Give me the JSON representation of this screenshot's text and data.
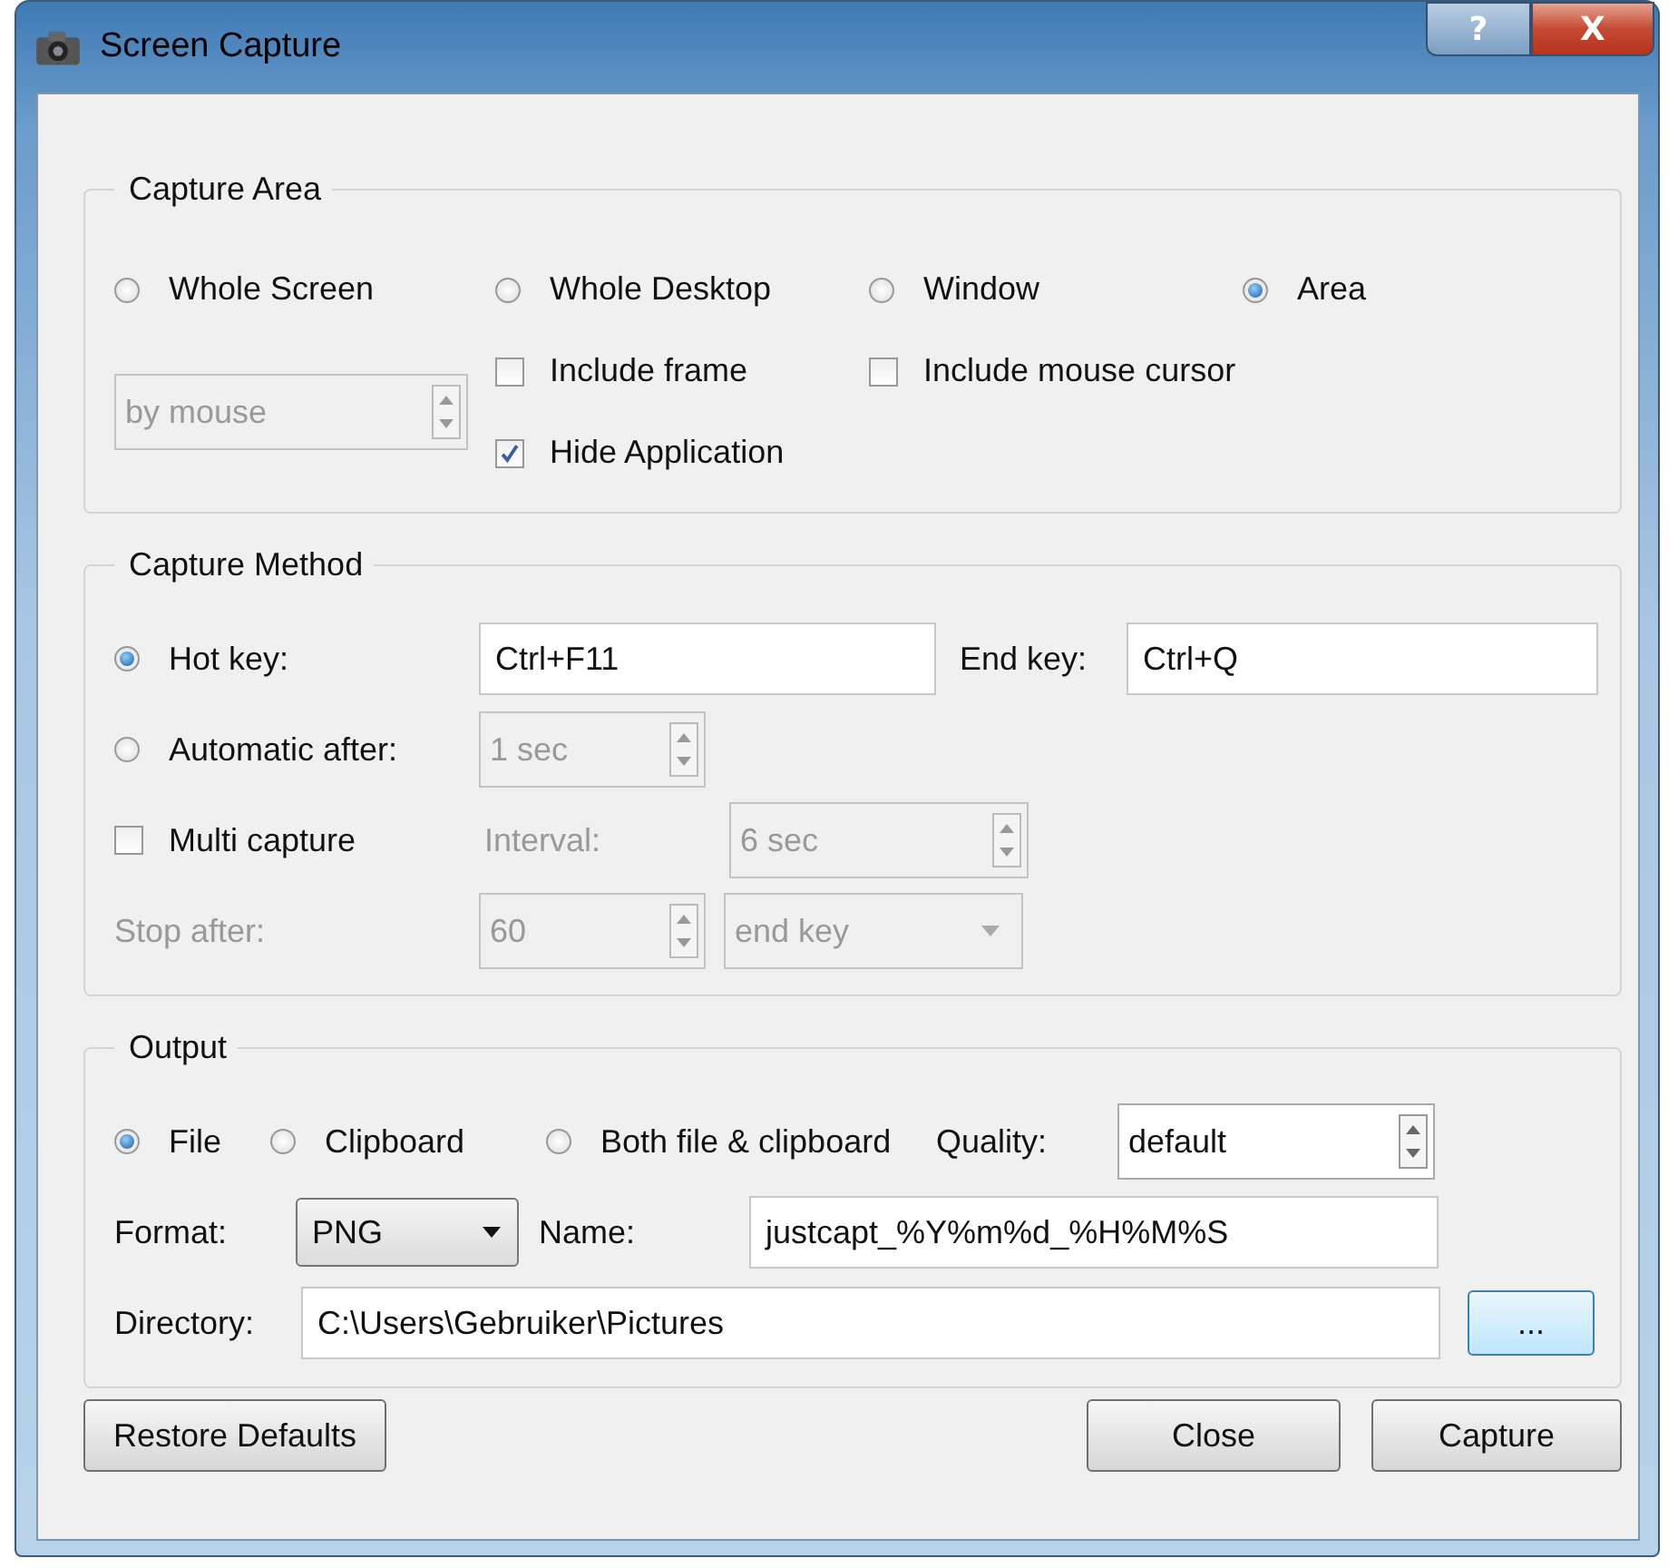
{
  "window": {
    "title": "Screen Capture",
    "buttons": [
      {
        "kind": "help",
        "label": "?"
      },
      {
        "kind": "close",
        "label": "X"
      }
    ]
  },
  "capture_area": {
    "title": "Capture Area",
    "modes": [
      {
        "label": "Whole Screen",
        "selected": false
      },
      {
        "label": "Whole Desktop",
        "selected": false
      },
      {
        "label": "Window",
        "selected": false
      },
      {
        "label": "Area",
        "selected": true
      }
    ],
    "area_source": {
      "value": "by mouse",
      "disabled": true
    },
    "options": [
      {
        "label": "Include frame",
        "checked": false
      },
      {
        "label": "Include mouse cursor",
        "checked": false
      },
      {
        "label": "Hide Application",
        "checked": true
      }
    ]
  },
  "capture_method": {
    "title": "Capture Method",
    "hot_key": {
      "label": "Hot key:",
      "selected": true,
      "value": "Ctrl+F11"
    },
    "end_key": {
      "label": "End key:",
      "value": "Ctrl+Q"
    },
    "automatic": {
      "label": "Automatic after:",
      "selected": false,
      "value": "1 sec",
      "disabled": true
    },
    "multi": {
      "label": "Multi capture",
      "checked": false
    },
    "interval": {
      "label": "Interval:",
      "value": "6 sec",
      "disabled": true
    },
    "stop_after": {
      "label": "Stop after:",
      "value": "60",
      "disabled": true
    },
    "stop_mode": {
      "value": "end key",
      "disabled": true
    }
  },
  "output": {
    "title": "Output",
    "targets": [
      {
        "label": "File",
        "selected": true
      },
      {
        "label": "Clipboard",
        "selected": false
      },
      {
        "label": "Both file & clipboard",
        "selected": false
      }
    ],
    "quality": {
      "label": "Quality:",
      "value": "default",
      "disabled": false
    },
    "format": {
      "label": "Format:",
      "value": "PNG"
    },
    "name": {
      "label": "Name:",
      "value": "justcapt_%Y%m%d_%H%M%S"
    },
    "directory": {
      "label": "Directory:",
      "value": "C:\\Users\\Gebruiker\\Pictures"
    },
    "browse": {
      "label": "..."
    }
  },
  "buttons": [
    {
      "label": "Restore Defaults"
    },
    {
      "label": "Close"
    },
    {
      "label": "Capture"
    }
  ]
}
